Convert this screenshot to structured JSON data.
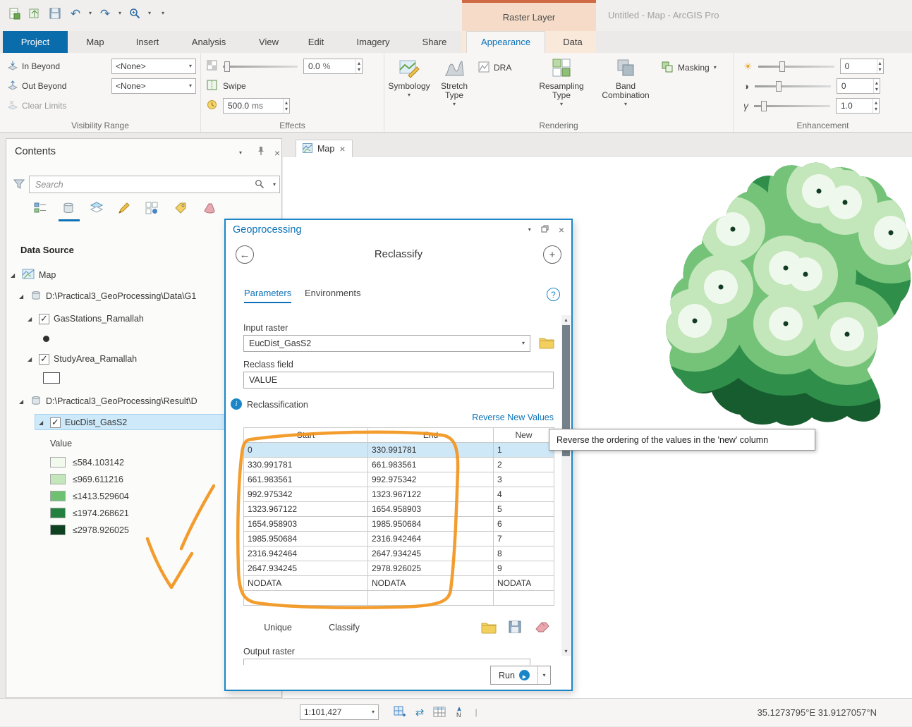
{
  "window": {
    "title": "Untitled - Map - ArcGIS Pro",
    "contextual_group": "Raster Layer"
  },
  "ribbon": {
    "tabs": {
      "project": "Project",
      "map": "Map",
      "insert": "Insert",
      "analysis": "Analysis",
      "view": "View",
      "edit": "Edit",
      "imagery": "Imagery",
      "share": "Share",
      "appearance": "Appearance",
      "data": "Data"
    },
    "visibility": {
      "label": "Visibility Range",
      "in_beyond": "In Beyond",
      "out_beyond": "Out Beyond",
      "clear_limits": "Clear Limits",
      "in_beyond_value": "<None>",
      "out_beyond_value": "<None>"
    },
    "effects": {
      "label": "Effects",
      "transparency_value": "0.0",
      "transparency_unit": "%",
      "swipe": "Swipe",
      "flicker_value": "500.0",
      "flicker_unit": "ms"
    },
    "rendering": {
      "label": "Rendering",
      "symbology": "Symbology",
      "stretch_line1": "Stretch",
      "stretch_line2": "Type",
      "dra": "DRA",
      "resampling_line1": "Resampling",
      "resampling_line2": "Type",
      "band_line1": "Band",
      "band_line2": "Combination",
      "masking": "Masking"
    },
    "enhancement": {
      "label": "Enhancement",
      "brightness_value": "0",
      "contrast_value": "0",
      "gamma_value": "1.0"
    }
  },
  "contents": {
    "title": "Contents",
    "search_placeholder": "Search",
    "section_title": "Data Source",
    "tree": {
      "map": "Map",
      "gdb1": "D:\\Practical3_GeoProcessing\\Data\\G1",
      "gas_stations": "GasStations_Ramallah",
      "study_area": "StudyArea_Ramallah",
      "gdb2": "D:\\Practical3_GeoProcessing\\Result\\D",
      "eucdist": "EucDist_GasS2"
    },
    "legend": {
      "field_label": "Value",
      "classes": [
        {
          "label": "≤584.103142",
          "color": "#f2faee"
        },
        {
          "label": "≤969.611216",
          "color": "#c3e6ba"
        },
        {
          "label": "≤1413.529604",
          "color": "#6fc172"
        },
        {
          "label": "≤1974.268621",
          "color": "#23813f"
        },
        {
          "label": "≤2978.926025",
          "color": "#0d4120"
        }
      ]
    }
  },
  "map": {
    "tab_label": "Map"
  },
  "geoprocessing": {
    "title": "Geoprocessing",
    "tool_title": "Reclassify",
    "tabs": {
      "parameters": "Parameters",
      "environments": "Environments"
    },
    "input_raster_label": "Input raster",
    "input_raster_value": "EucDist_GasS2",
    "reclass_field_label": "Reclass field",
    "reclass_field_value": "VALUE",
    "section_label": "Reclassification",
    "reverse_link": "Reverse New Values",
    "table": {
      "headers": [
        "Start",
        "End",
        "New"
      ],
      "rows": [
        [
          "0",
          "330.991781",
          "1"
        ],
        [
          "330.991781",
          "661.983561",
          "2"
        ],
        [
          "661.983561",
          "992.975342",
          "3"
        ],
        [
          "992.975342",
          "1323.967122",
          "4"
        ],
        [
          "1323.967122",
          "1654.958903",
          "5"
        ],
        [
          "1654.958903",
          "1985.950684",
          "6"
        ],
        [
          "1985.950684",
          "2316.942464",
          "7"
        ],
        [
          "2316.942464",
          "2647.934245",
          "8"
        ],
        [
          "2647.934245",
          "2978.926025",
          "9"
        ],
        [
          "NODATA",
          "NODATA",
          "NODATA"
        ],
        [
          "",
          "",
          ""
        ]
      ]
    },
    "unique_button": "Unique",
    "classify_button": "Classify",
    "output_raster_label": "Output raster",
    "run_button": "Run"
  },
  "tooltip": {
    "text": "Reverse the ordering of the values in the 'new' column"
  },
  "statusbar": {
    "scale": "1:101,427",
    "coordinates": "35.1273795°E 31.9127057°N"
  },
  "colors": {
    "accent_blue": "#0c72b8",
    "annotation_orange": "#f2951d",
    "contextual_peach": "#f6dcc8",
    "selection_blue": "#cfe8f8"
  }
}
